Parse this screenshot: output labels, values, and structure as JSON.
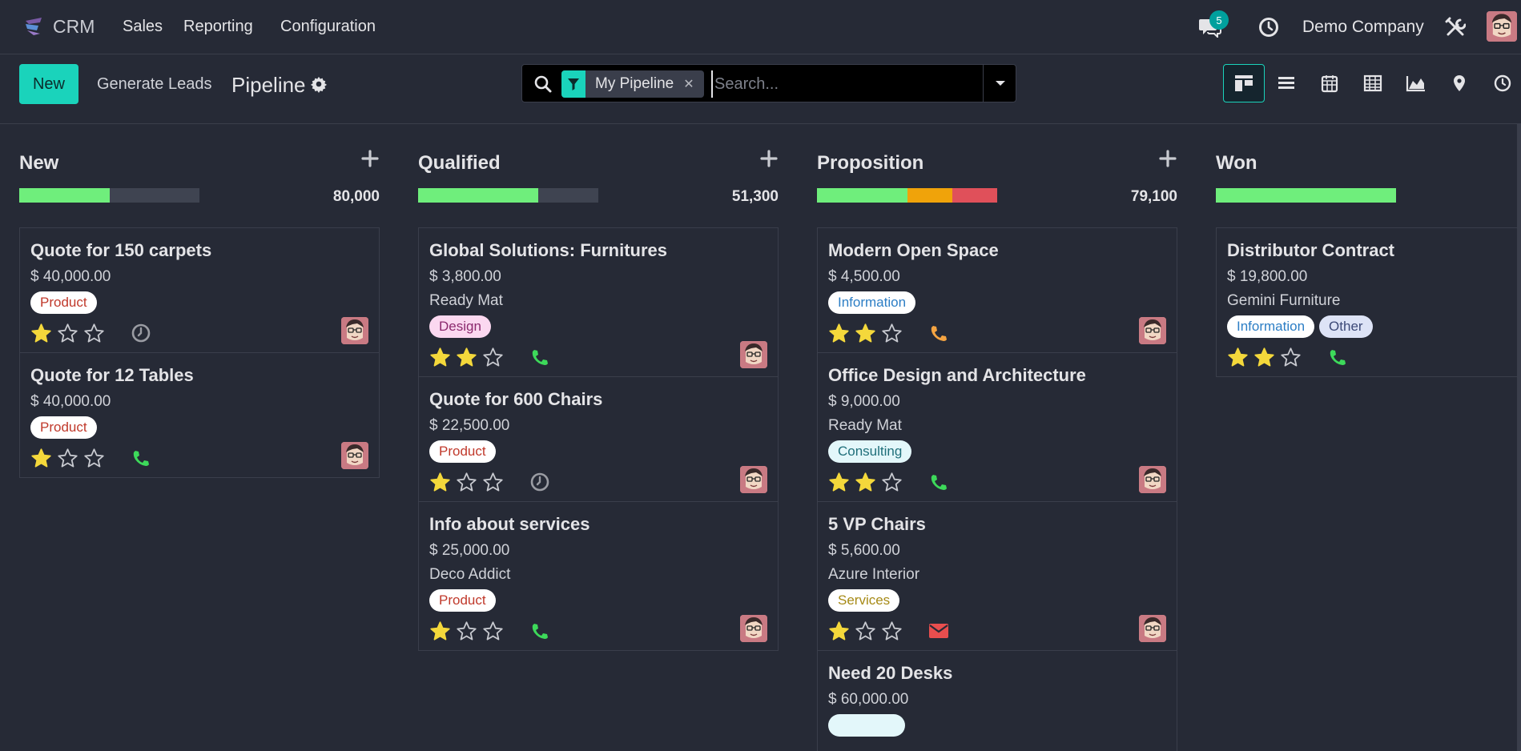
{
  "topnav": {
    "brand": "CRM",
    "menu": [
      "Sales",
      "Reporting",
      "Configuration"
    ],
    "messages_count": "5",
    "company": "Demo Company"
  },
  "controlbar": {
    "new_label": "New",
    "generate_leads_label": "Generate Leads",
    "title": "Pipeline",
    "search": {
      "facet": "My Pipeline",
      "placeholder": "Search..."
    },
    "views": [
      "kanban",
      "list",
      "calendar",
      "pivot",
      "graph",
      "map",
      "activity"
    ],
    "active_view": "kanban"
  },
  "colors": {
    "accent": "#1ad3bb",
    "progress_green": "#6fee7c",
    "progress_orange": "#f0a30a",
    "progress_red": "#e0505a",
    "progress_grey": "#3f4451",
    "star_filled": "#f4d83b",
    "phone": "#3dd95a",
    "clock": "#9a9ca3",
    "envelope": "#e84e4e",
    "phone_warning": "#f5a442"
  },
  "columns": [
    {
      "name": "New",
      "total": "80,000",
      "progress": [
        {
          "color": "green",
          "fraction": 0.5
        },
        {
          "color": "grey",
          "fraction": 0.5
        }
      ],
      "cards": [
        {
          "title": "Quote for 150 carpets",
          "amount": "$ 40,000.00",
          "company": "",
          "tags": [
            {
              "label": "Product",
              "style": "product"
            }
          ],
          "stars": 1,
          "activity": "clock"
        },
        {
          "title": "Quote for 12 Tables",
          "amount": "$ 40,000.00",
          "company": "",
          "tags": [
            {
              "label": "Product",
              "style": "product"
            }
          ],
          "stars": 1,
          "activity": "phone"
        }
      ]
    },
    {
      "name": "Qualified",
      "total": "51,300",
      "progress": [
        {
          "color": "green",
          "fraction": 0.667
        },
        {
          "color": "grey",
          "fraction": 0.333
        }
      ],
      "cards": [
        {
          "title": "Global Solutions: Furnitures",
          "amount": "$ 3,800.00",
          "company": "Ready Mat",
          "tags": [
            {
              "label": "Design",
              "style": "design"
            }
          ],
          "stars": 2,
          "activity": "phone"
        },
        {
          "title": "Quote for 600 Chairs",
          "amount": "$ 22,500.00",
          "company": "",
          "tags": [
            {
              "label": "Product",
              "style": "product"
            }
          ],
          "stars": 1,
          "activity": "clock"
        },
        {
          "title": "Info about services",
          "amount": "$ 25,000.00",
          "company": "Deco Addict",
          "tags": [
            {
              "label": "Product",
              "style": "product"
            }
          ],
          "stars": 1,
          "activity": "phone"
        }
      ]
    },
    {
      "name": "Proposition",
      "total": "79,100",
      "progress": [
        {
          "color": "green",
          "fraction": 0.5
        },
        {
          "color": "orange",
          "fraction": 0.25
        },
        {
          "color": "red",
          "fraction": 0.25
        }
      ],
      "cards": [
        {
          "title": "Modern Open Space",
          "amount": "$ 4,500.00",
          "company": "",
          "tags": [
            {
              "label": "Information",
              "style": "information"
            }
          ],
          "stars": 2,
          "activity": "phone-warning"
        },
        {
          "title": "Office Design and Architecture",
          "amount": "$ 9,000.00",
          "company": "Ready Mat",
          "tags": [
            {
              "label": "Consulting",
              "style": "consulting"
            }
          ],
          "stars": 2,
          "activity": "phone"
        },
        {
          "title": "5 VP Chairs",
          "amount": "$ 5,600.00",
          "company": "Azure Interior",
          "tags": [
            {
              "label": "Services",
              "style": "services"
            }
          ],
          "stars": 1,
          "activity": "envelope"
        },
        {
          "title": "Need 20 Desks",
          "amount": "$ 60,000.00",
          "company": "",
          "tags": [
            {
              "label": "",
              "style": "consulting"
            }
          ],
          "stars": 0,
          "activity": "",
          "partial": true
        }
      ]
    },
    {
      "name": "Won",
      "total": "",
      "progress": [
        {
          "color": "green",
          "fraction": 1.0
        }
      ],
      "cards": [
        {
          "title": "Distributor Contract",
          "amount": "$ 19,800.00",
          "company": "Gemini Furniture",
          "tags": [
            {
              "label": "Information",
              "style": "information"
            },
            {
              "label": "Other",
              "style": "other"
            }
          ],
          "stars": 2,
          "activity": "phone"
        }
      ]
    }
  ]
}
